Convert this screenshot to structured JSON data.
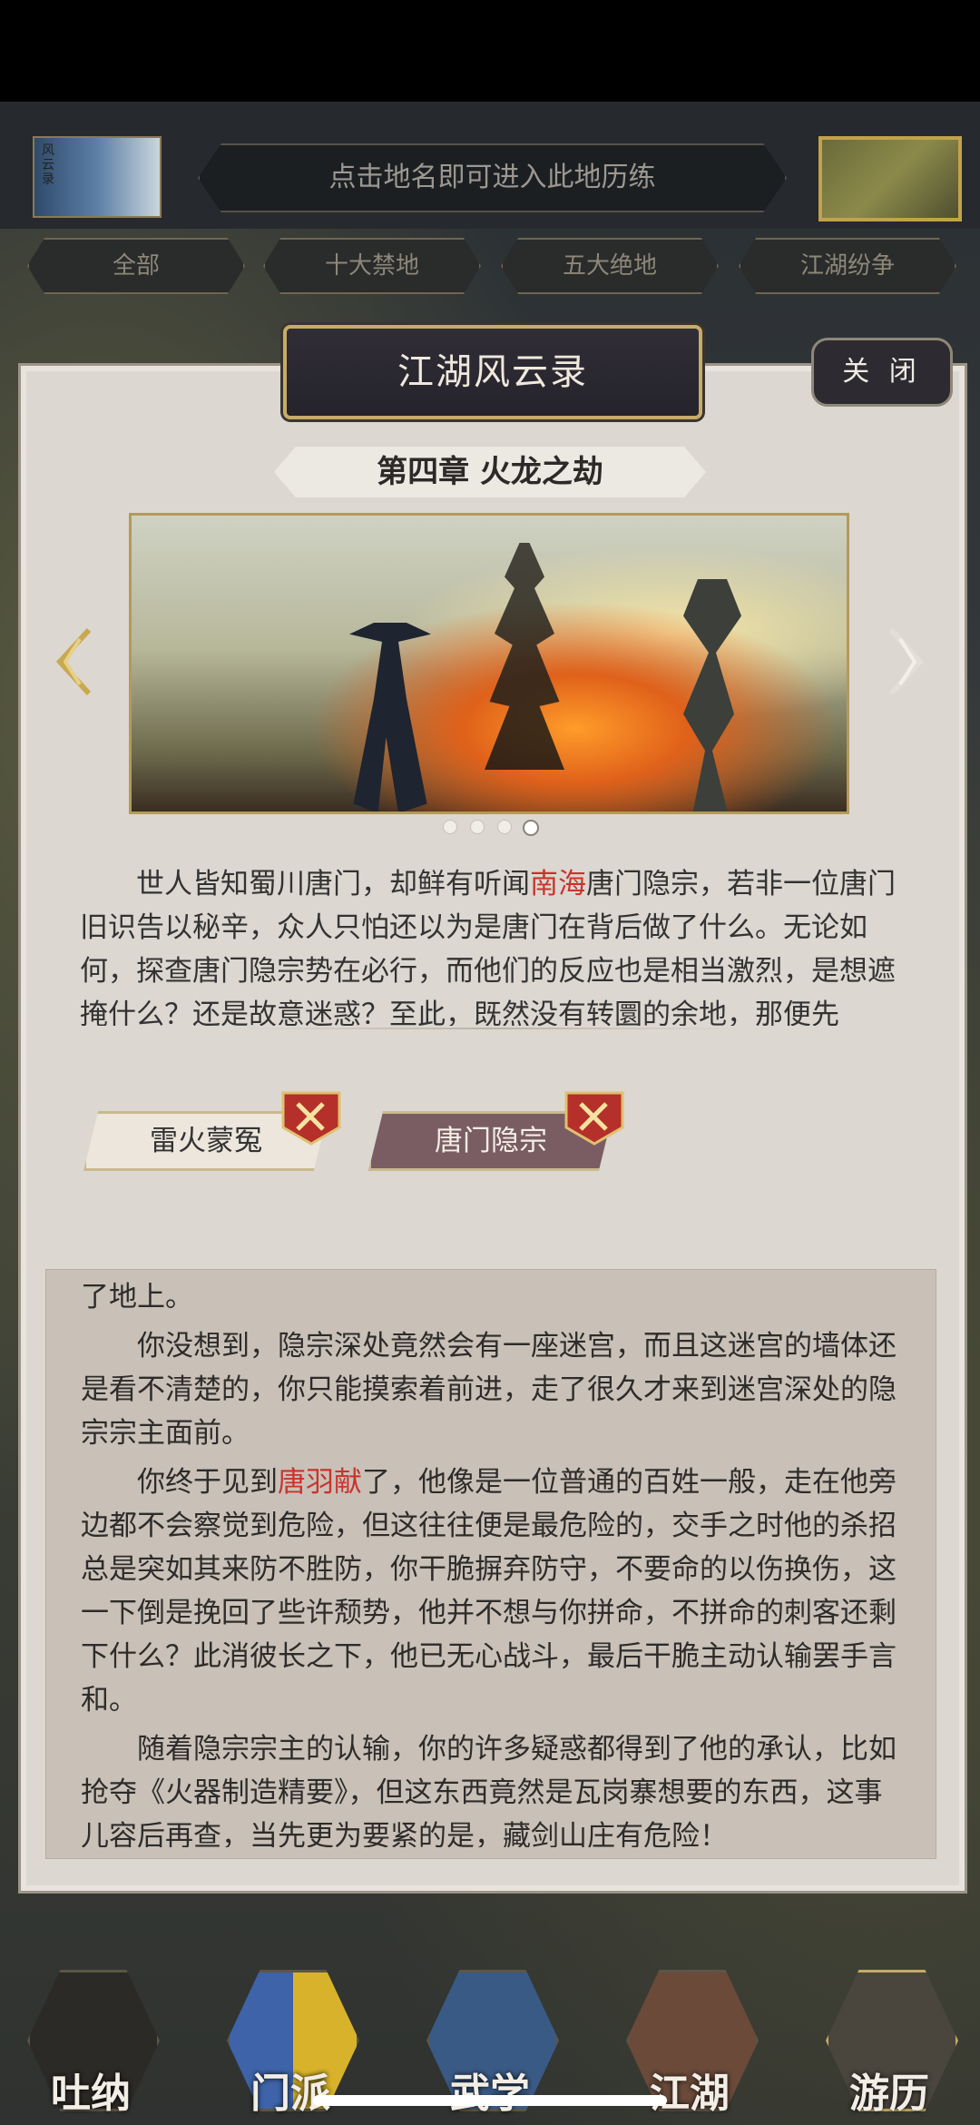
{
  "header": {
    "hint": "点击地名即可进入此地历练",
    "scroll_icon_text": "风云录"
  },
  "filters": [
    "全部",
    "十大禁地",
    "五大绝地",
    "江湖纷争"
  ],
  "modal": {
    "title": "江湖风云录",
    "close_label": "关 闭",
    "chapter": "第四章  火龙之劫",
    "carousel": {
      "total": 4,
      "active_index": 3
    },
    "story": {
      "p1_a": "世人皆知蜀川唐门，却鲜有听闻",
      "p1_hl": "南海",
      "p1_b": "唐门隐宗，若非一位唐门旧识告以秘辛，众人只怕还以为是唐门在背后做了什么。无论如何，探查唐门隐宗势在必行，而他们的反应也是相当激烈，是想遮掩什么？还是故意迷惑？至此，既然没有转圜的余地，那便先"
    },
    "paths": [
      {
        "label": "雷火蒙冤"
      },
      {
        "label": "唐门隐宗"
      }
    ],
    "log": {
      "line0": "了地上。",
      "p1": "你没想到，隐宗深处竟然会有一座迷宫，而且这迷宫的墙体还是看不清楚的，你只能摸索着前进，走了很久才来到迷宫深处的隐宗宗主面前。",
      "p2_a": "你终于见到",
      "p2_hl": "唐羽献",
      "p2_b": "了，他像是一位普通的百姓一般，走在他旁边都不会察觉到危险，但这往往便是最危险的，交手之时他的杀招总是突如其来防不胜防，你干脆摒弃防守，不要命的以伤换伤，这一下倒是挽回了些许颓势，他并不想与你拼命，不拼命的刺客还剩下什么？此消彼长之下，他已无心战斗，最后干脆主动认输罢手言和。",
      "p3": "随着隐宗宗主的认输，你的许多疑惑都得到了他的承认，比如抢夺《火器制造精要》，但这东西竟然是瓦岗寨想要的东西，这事儿容后再查，当先更为要紧的是，藏剑山庄有危险！"
    }
  },
  "bottom_nav": [
    "吐纳",
    "门派",
    "武学",
    "江湖",
    "游历"
  ],
  "colors": {
    "highlight": "#c8342c",
    "gold_border": "#c7ab66",
    "panel": "#dcd7d1"
  }
}
